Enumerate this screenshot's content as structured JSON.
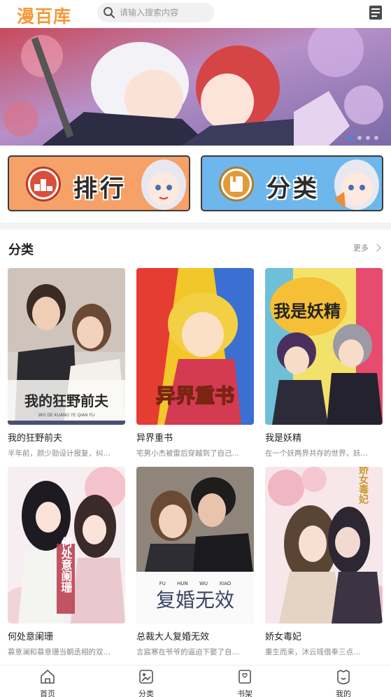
{
  "header": {
    "logo": "漫百库",
    "search_placeholder": "请输入搜索内容",
    "logo_color": "#f59a3a"
  },
  "banner": {
    "slide_count": 4,
    "active_slide": 1
  },
  "entries": {
    "rank_label": "排行",
    "category_label": "分类"
  },
  "section": {
    "title": "分类",
    "more": "更多"
  },
  "cards": [
    {
      "title": "我的狂野前夫",
      "desc": "半年前，颜少勋设计报复，纠…",
      "cover_text": "我的狂野前夫",
      "cover_sub": "WO DE KUANG YE QIAN FU"
    },
    {
      "title": "异界重书",
      "desc": "宅男小杰被雷后穿越到了自己…",
      "cover_text": "异界重书"
    },
    {
      "title": "我是妖精",
      "desc": "在一个妖两界共存的世界，妖…",
      "cover_text": "我是妖精"
    },
    {
      "title": "何处意阑珊",
      "desc": "慕意澜和慕意珊当朝丞相的双…",
      "cover_text": "何处意阑珊"
    },
    {
      "title": "总裁大人复婚无效",
      "desc": "言宸寒在爷爷的逼迫下娶了自…",
      "cover_text": "复婚无效",
      "cover_pinyin": [
        "FU",
        "HUN",
        "WU",
        "XIAO"
      ]
    },
    {
      "title": "娇女毒妃",
      "desc": "重生而来，沐云瑶借奉三点…",
      "cover_text": "娇女毒妃"
    }
  ],
  "tabbar": {
    "items": [
      {
        "label": "首页",
        "icon": "home-icon"
      },
      {
        "label": "分类",
        "icon": "category-icon"
      },
      {
        "label": "书架",
        "icon": "bookshelf-icon"
      },
      {
        "label": "我的",
        "icon": "profile-icon"
      }
    ]
  }
}
